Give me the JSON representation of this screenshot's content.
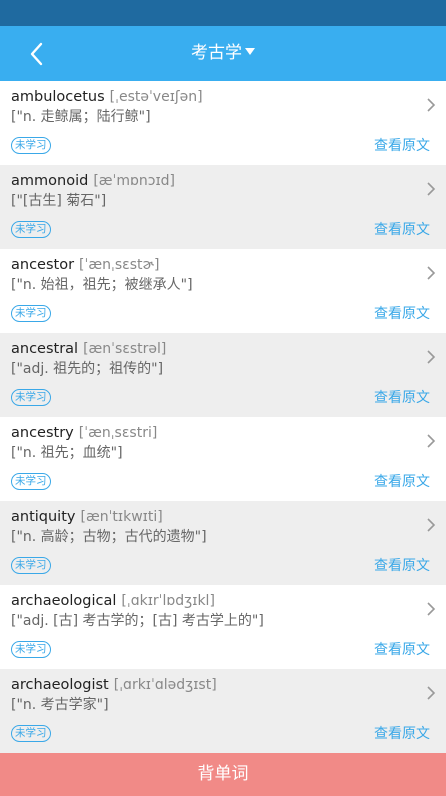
{
  "nav": {
    "title": "考古学"
  },
  "colors": {
    "status_bar": "#1f6aa0",
    "nav_bar": "#39aef0",
    "accent": "#3aa8e8",
    "bottom_button": "#f18a87",
    "row_alt": "#eeeeee"
  },
  "words": [
    {
      "word": "ambulocetus",
      "phonetic": "[ˌestəˈveɪʃən]",
      "definition": "[\"n. 走鲸属；陆行鲸\"]",
      "status": "未学习",
      "action": "查看原文"
    },
    {
      "word": "ammonoid",
      "phonetic": "[æˈmɒnɔɪd]",
      "definition": "[\"[古生] 菊石\"]",
      "status": "未学习",
      "action": "查看原文"
    },
    {
      "word": "ancestor",
      "phonetic": "[ˈænˌsɛstɚ]",
      "definition": "[\"n. 始祖，祖先；被继承人\"]",
      "status": "未学习",
      "action": "查看原文"
    },
    {
      "word": "ancestral",
      "phonetic": "[ænˈsɛstrəl]",
      "definition": "[\"adj. 祖先的；祖传的\"]",
      "status": "未学习",
      "action": "查看原文"
    },
    {
      "word": "ancestry",
      "phonetic": "[ˈænˌsɛstri]",
      "definition": "[\"n. 祖先；血统\"]",
      "status": "未学习",
      "action": "查看原文"
    },
    {
      "word": "antiquity",
      "phonetic": "[ænˈtɪkwɪti]",
      "definition": "[\"n. 高龄；古物；古代的遗物\"]",
      "status": "未学习",
      "action": "查看原文"
    },
    {
      "word": "archaeological",
      "phonetic": "[ˌɑkɪrˈlɒdʒɪkl]",
      "definition": "[\"adj. [古] 考古学的；[古] 考古学上的\"]",
      "status": "未学习",
      "action": "查看原文"
    },
    {
      "word": "archaeologist",
      "phonetic": "[ˌɑrkɪˈɑlədʒɪst]",
      "definition": "[\"n. 考古学家\"]",
      "status": "未学习",
      "action": "查看原文"
    }
  ],
  "bottom_button": {
    "label": "背单词"
  }
}
